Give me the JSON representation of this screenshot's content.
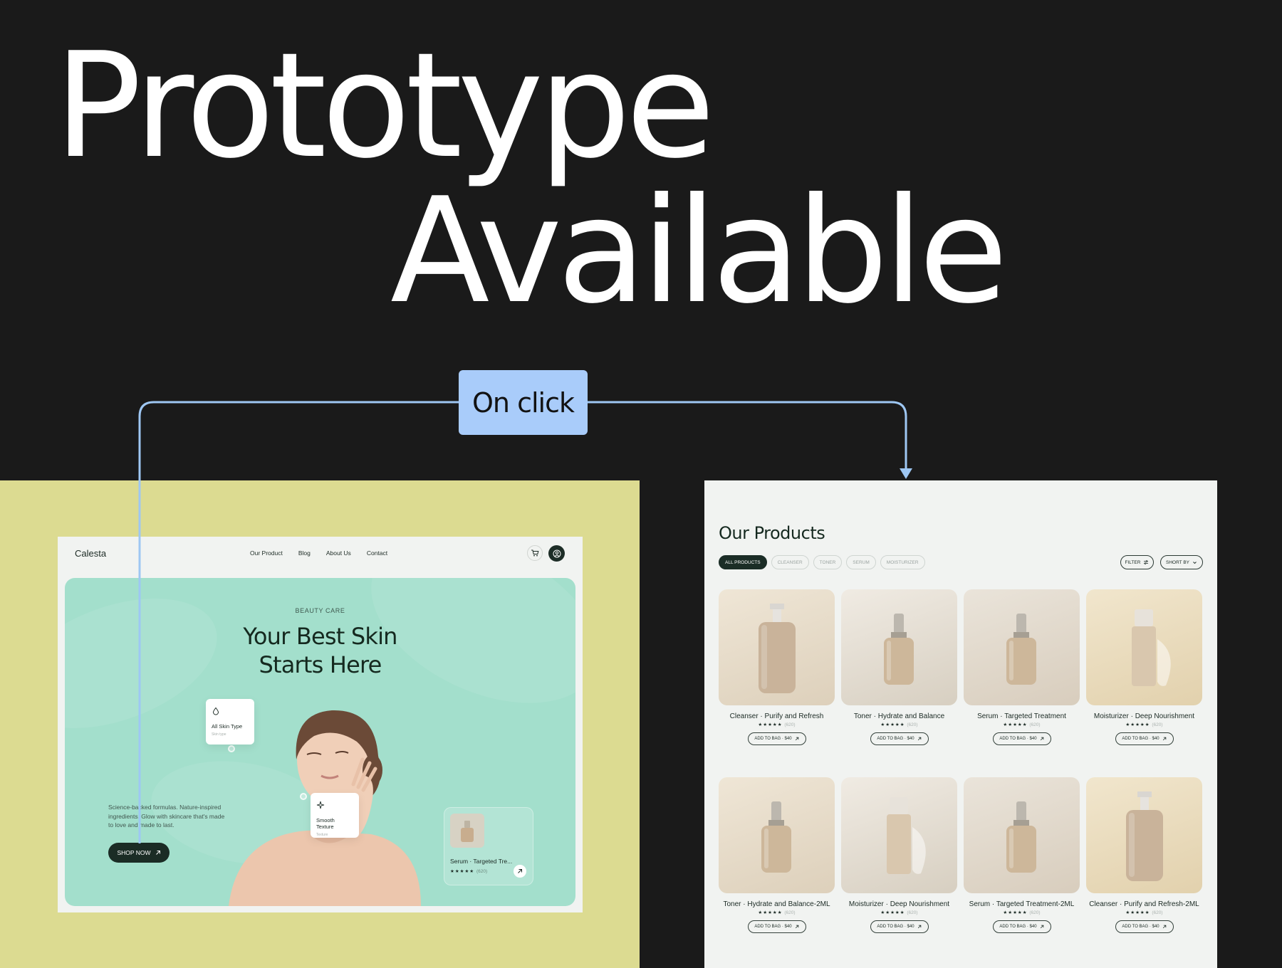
{
  "headline": {
    "line1": "Prototype",
    "line2": "Available"
  },
  "flow": {
    "trigger_label": "On click"
  },
  "home": {
    "brand": "Calesta",
    "nav": [
      "Our Product",
      "Blog",
      "About Us",
      "Contact"
    ],
    "hero": {
      "eyebrow": "BEAUTY CARE",
      "title_line1": "Your Best Skin",
      "title_line2": "Starts Here",
      "description": "Science-backed formulas. Nature-inspired ingredients. Glow with skincare that's made to love and made to last.",
      "cta": "SHOP NOW"
    },
    "feature_cards": [
      {
        "title": "All Skin Type",
        "subtitle": "Skin type",
        "icon": "droplet-icon"
      },
      {
        "title": "Smooth Texture",
        "subtitle": "Texture",
        "icon": "sparkle-icon"
      }
    ],
    "featured_product": {
      "name": "Serum · Targeted Tre...",
      "stars": "★★★★★",
      "reviews": "(620)"
    }
  },
  "products_page": {
    "title": "Our Products",
    "filters": [
      "ALL PRODUCTS",
      "CLEANSER",
      "TONER",
      "SERUM",
      "MOISTURIZER"
    ],
    "active_filter": "ALL PRODUCTS",
    "filter_button": "FILTER",
    "sort_button": "SHORT BY",
    "products": [
      {
        "name": "Cleanser · Purify and Refresh",
        "stars": "★★★★★",
        "reviews": "(620)",
        "button": "ADD TO BAG · $40"
      },
      {
        "name": "Toner · Hydrate and Balance",
        "stars": "★★★★★",
        "reviews": "(620)",
        "button": "ADD TO BAG · $40"
      },
      {
        "name": "Serum · Targeted Treatment",
        "stars": "★★★★★",
        "reviews": "(620)",
        "button": "ADD TO BAG · $40"
      },
      {
        "name": "Moisturizer · Deep Nourishment",
        "stars": "★★★★★",
        "reviews": "(620)",
        "button": "ADD TO BAG · $40"
      },
      {
        "name": "Toner · Hydrate and Balance-2ML",
        "stars": "★★★★★",
        "reviews": "(620)",
        "button": "ADD TO BAG · $40"
      },
      {
        "name": "Moisturizer · Deep Nourishment",
        "stars": "★★★★★",
        "reviews": "(620)",
        "button": "ADD TO BAG · $40"
      },
      {
        "name": "Serum · Targeted Treatment-2ML",
        "stars": "★★★★★",
        "reviews": "(620)",
        "button": "ADD TO BAG · $40"
      },
      {
        "name": "Cleanser · Purify and Refresh-2ML",
        "stars": "★★★★★",
        "reviews": "(620)",
        "button": "ADD TO BAG · $40"
      }
    ]
  },
  "colors": {
    "canvas": "#1a1a1a",
    "trigger": "#a9ccfa",
    "connector": "#9ec7f3",
    "left_panel": "#dcdb91",
    "hero": "#a3dfcc",
    "brand_dark": "#1b2d26",
    "products_bg": "#f1f3f1"
  }
}
